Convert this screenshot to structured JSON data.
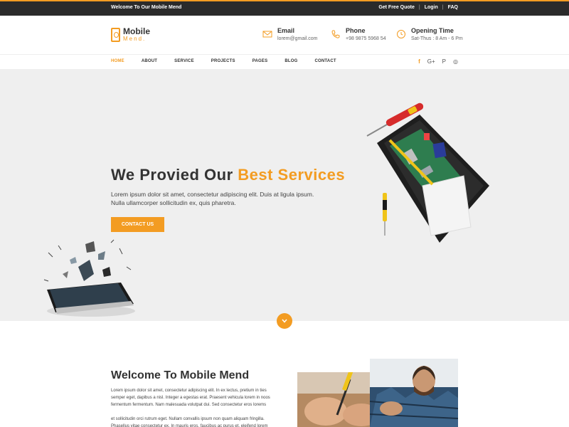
{
  "topbar": {
    "welcome": "Welcome To Our Mobile Mend",
    "links": [
      "Get Free Quote",
      "Login",
      "FAQ"
    ],
    "separator": "|"
  },
  "logo": {
    "line1": "Mobile",
    "line2": "Mend."
  },
  "header_info": {
    "email": {
      "title": "Email",
      "value": "lorem@gmail.com",
      "icon": "envelope-icon"
    },
    "phone": {
      "title": "Phone",
      "value": "+98 9875 5968 54",
      "icon": "phone-icon"
    },
    "hours": {
      "title": "Opening Time",
      "value": "Sat-Thus : 8 Am - 6 Pm",
      "icon": "clock-icon"
    }
  },
  "nav": {
    "items": [
      "HOME",
      "ABOUT",
      "SERVICE",
      "PROJECTS",
      "PAGES",
      "BLOG",
      "CONTACT"
    ],
    "active": "HOME",
    "social": [
      "f",
      "G+",
      "P",
      "◎"
    ]
  },
  "hero": {
    "title_part1": "We Provied Our ",
    "title_accent": "Best Services",
    "description": "Lorem ipsum dolor sit amet, consectetur adipiscing elit. Duis at ligula ipsum. Nulla ullamcorper sollicitudin ex, quis pharetra.",
    "button": "CONTACT US"
  },
  "about": {
    "title": "Welcome To Mobile Mend",
    "para1": "Lorem ipsum dolor sit amet, consectetur adipiscing elit. In ex lectus, pretium in ties semper eget, dapibus a nisl. Integer a egestas erat. Praesent vehicula lorem in noos fermentum fermentum. Nam malesuada volutpat dui. Sed consectetur eros lorems",
    "para2": "et sollicitudin orci rutrum eget. Nullam convallis ipsum non quam aliquam fringilla. Phasellus vitae consectetur ex. In mauris eros, faucibus ac purus et, eleifend lorem"
  },
  "colors": {
    "accent": "#f39c22",
    "topbar": "#2b2b2b",
    "hero_bg": "#efefef"
  }
}
